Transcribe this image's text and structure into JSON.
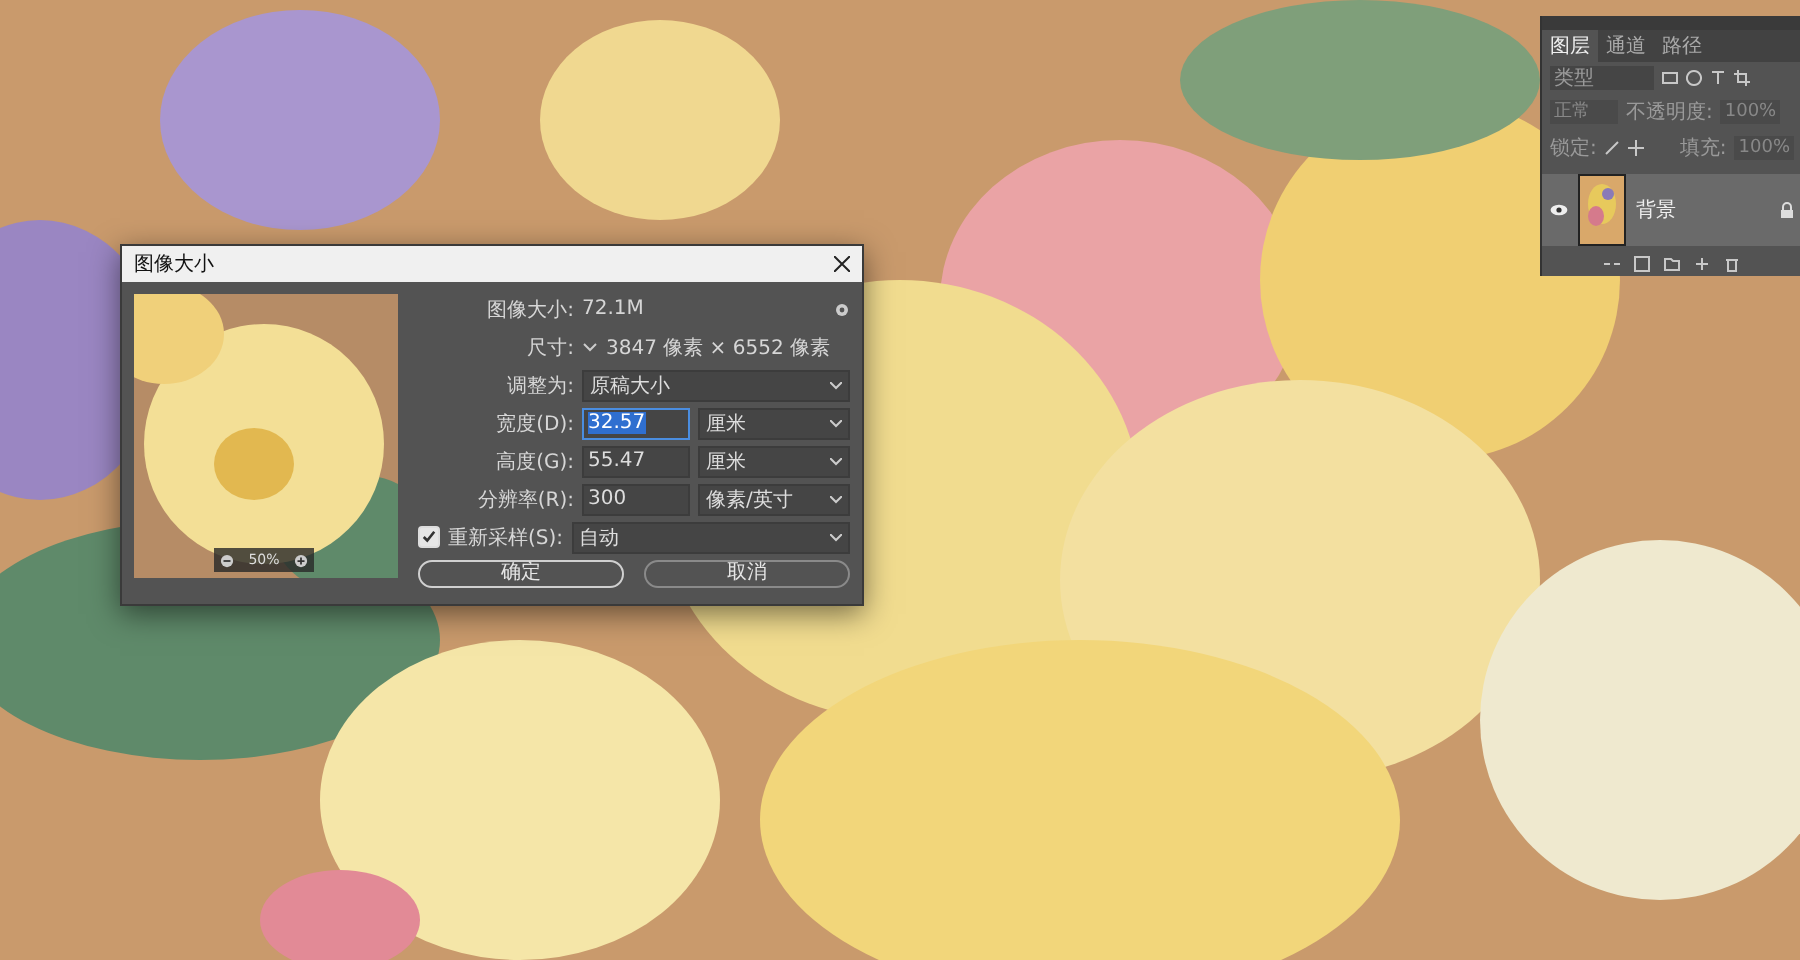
{
  "dialog": {
    "title": "图像大小",
    "size_label": "图像大小:",
    "size_value": "72.1M",
    "dimensions_label": "尺寸:",
    "dimensions_value": "3847 像素 × 6552 像素",
    "fit_label": "调整为:",
    "fit_value": "原稿大小",
    "fields": [
      {
        "label": "宽度(D):",
        "value": "32.57",
        "unit": "厘米",
        "selected": true
      },
      {
        "label": "高度(G):",
        "value": "55.47",
        "unit": "厘米",
        "selected": false
      },
      {
        "label": "分辨率(R):",
        "value": "300",
        "unit": "像素/英寸",
        "selected": false
      }
    ],
    "resample": {
      "label": "重新采样(S):",
      "checked": true,
      "value": "自动"
    },
    "zoom": "50%",
    "buttons": [
      {
        "label": "确定",
        "selected": true
      },
      {
        "label": "取消",
        "selected": false
      }
    ]
  },
  "layers_panel": {
    "tabs": [
      {
        "label": "图层",
        "selected": true
      },
      {
        "label": "通道",
        "selected": false
      },
      {
        "label": "路径",
        "selected": false
      }
    ],
    "search_placeholder": "类型",
    "blend_mode": "正常",
    "opacity_label": "不透明度:",
    "opacity": "100%",
    "lock_label": "锁定:",
    "fill_label": "填充:",
    "fill": "100%",
    "layers": [
      {
        "name": "背景",
        "visible": true,
        "locked": true
      }
    ]
  }
}
